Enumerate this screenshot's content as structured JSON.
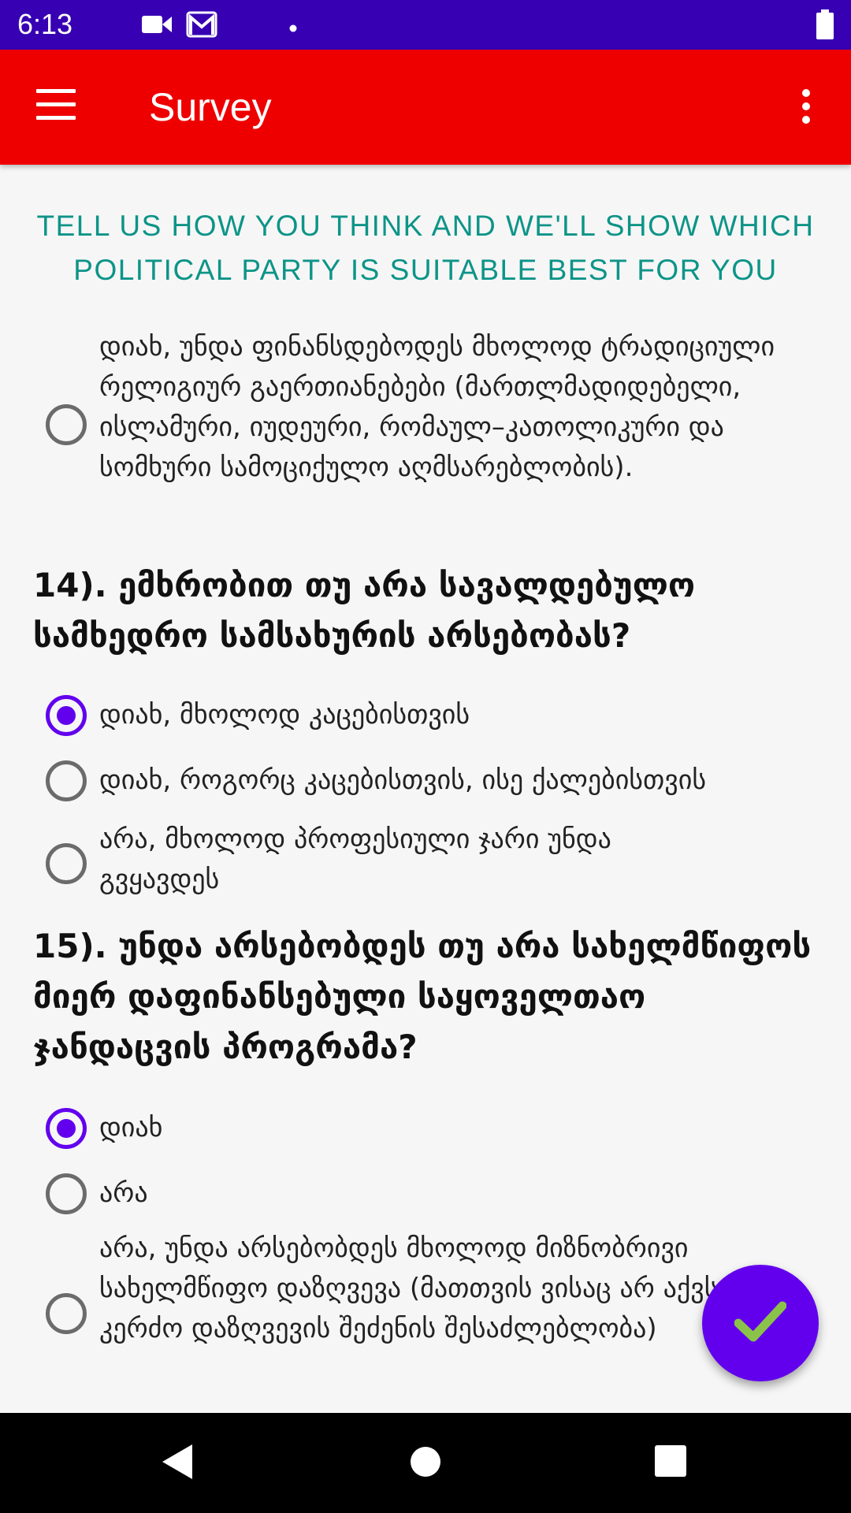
{
  "status_bar": {
    "time": "6:13",
    "icons": [
      "video-camera-icon",
      "gmail-icon",
      "dot-icon",
      "battery-icon"
    ]
  },
  "app_bar": {
    "title": "Survey",
    "menu_icon": "hamburger-menu-icon",
    "overflow_icon": "more-vertical-icon",
    "background_color": "#ee0000"
  },
  "headline": "TELL US HOW YOU THINK AND WE'LL SHOW WHICH POLITICAL PARTY IS SUITABLE BEST FOR YOU",
  "questions": [
    {
      "id": "q13",
      "options": [
        {
          "label": "დიახ, უნდა ფინანსდებოდეს მხოლოდ ტრადიციული რელიგიურ გაერთიანებები (მართლმადიდებელი, ისლამური, იუდეური, რომაულ–კათოლიკური და სომხური სამოციქულო აღმსარებლობის).",
          "selected": false
        }
      ]
    },
    {
      "id": "q14",
      "title": "14). ემხრობით თუ არა სავალდებულო სამხედრო სამსახურის არსებობას?",
      "options": [
        {
          "label": "დიახ, მხოლოდ კაცებისთვის",
          "selected": true
        },
        {
          "label": "დიახ, როგორც კაცებისთვის, ისე ქალებისთვის",
          "selected": false
        },
        {
          "label": "არა, მხოლოდ პროფესიული ჯარი უნდა გვყავდეს",
          "selected": false
        }
      ]
    },
    {
      "id": "q15",
      "title": "15). უნდა არსებობდეს თუ არა სახელმწიფოს მიერ დაფინანსებული საყოველთაო ჯანდაცვის პროგრამა?",
      "options": [
        {
          "label": "დიახ",
          "selected": true
        },
        {
          "label": "არა",
          "selected": false
        },
        {
          "label": "არა, უნდა არსებობდეს მხოლოდ მიზნობრივი სახელმწიფო დაზღვევა (მათთვის ვისაც არ აქვს კერძო დაზღვევის შეძენის შესაძლებლობა)",
          "selected": false
        }
      ]
    }
  ],
  "fab": {
    "icon": "checkmark-icon",
    "color": "#6200ee",
    "check_color": "#8bc34a"
  },
  "accent_color": "#6200ee",
  "headline_color": "#0d9488",
  "nav_bar": {
    "buttons": [
      "back-icon",
      "home-icon",
      "recents-icon"
    ]
  }
}
